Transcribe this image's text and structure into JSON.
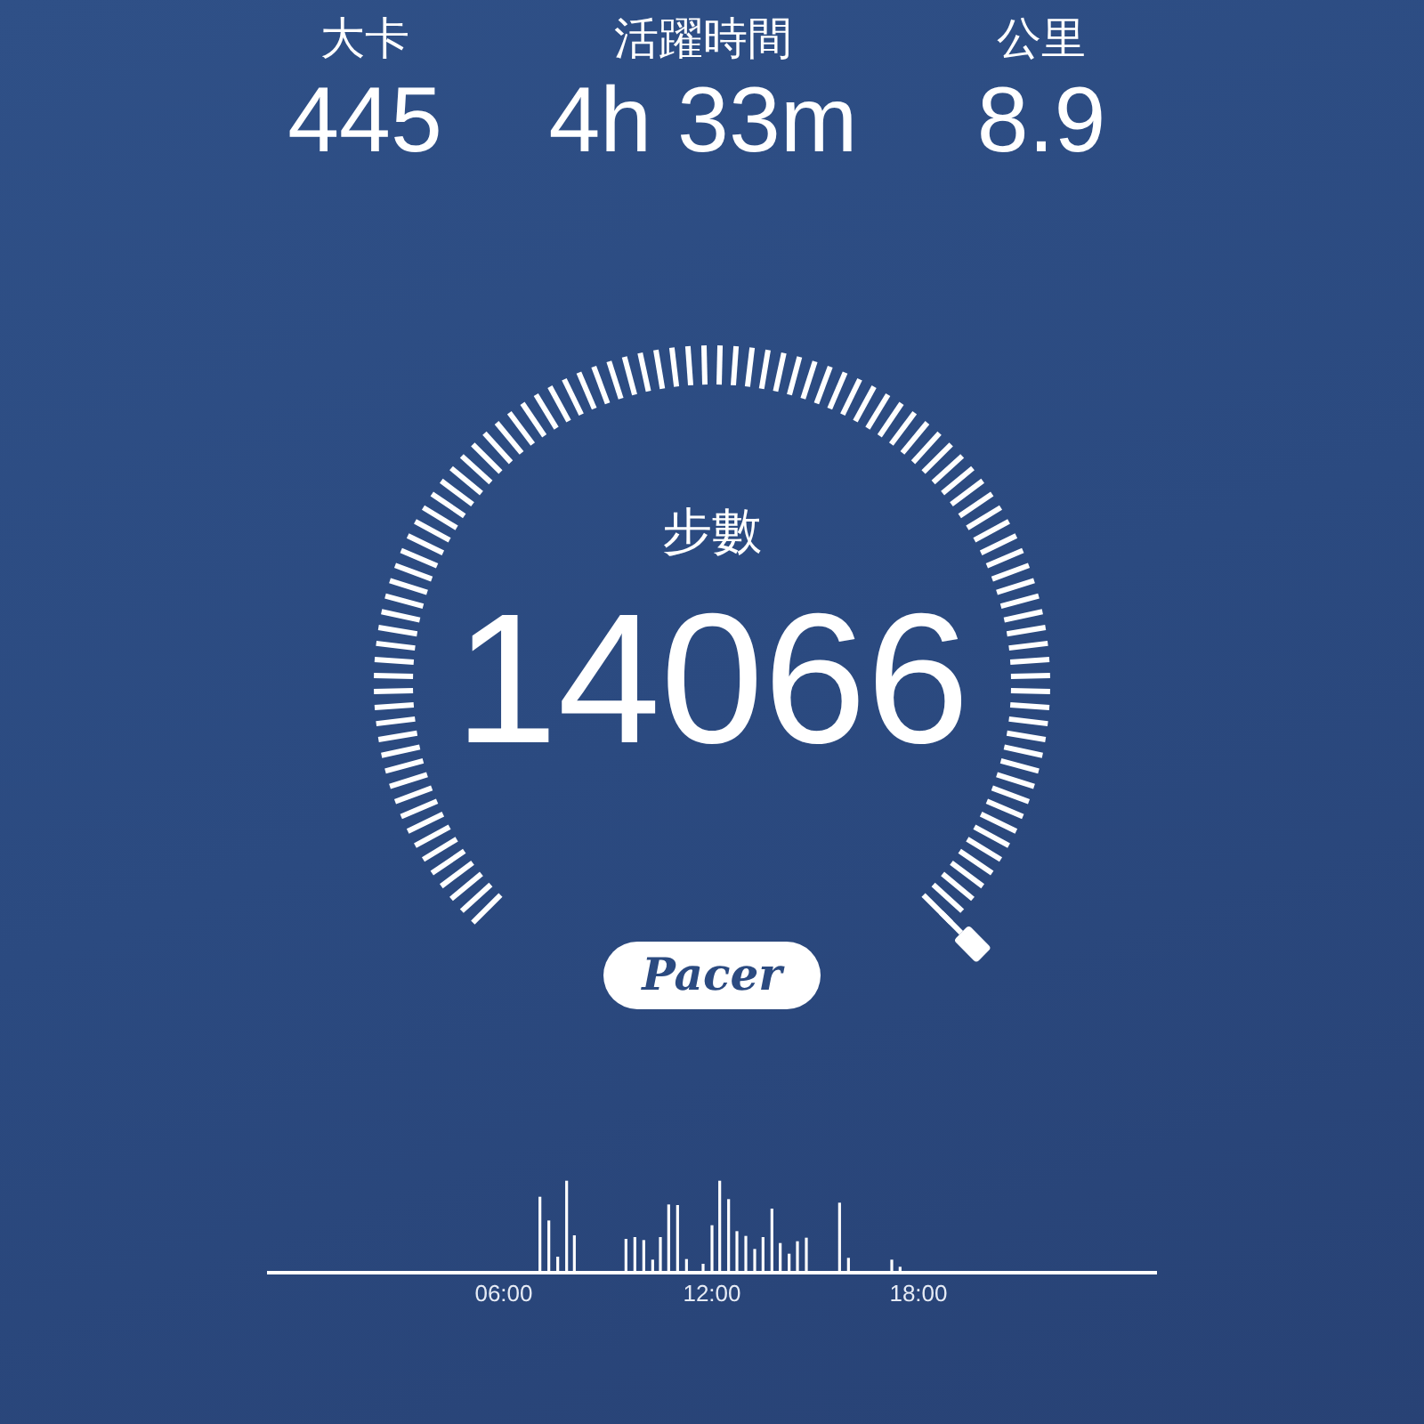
{
  "stats": [
    {
      "label": "大卡",
      "value": "445"
    },
    {
      "label": "活躍時間",
      "value": "4h 33m"
    },
    {
      "label": "公里",
      "value": "8.9"
    }
  ],
  "gauge": {
    "label": "步數",
    "value": "14066"
  },
  "logo": {
    "text": "Pacer"
  },
  "activity": {
    "x_labels": [
      "06:00",
      "12:00",
      "18:00"
    ]
  }
}
